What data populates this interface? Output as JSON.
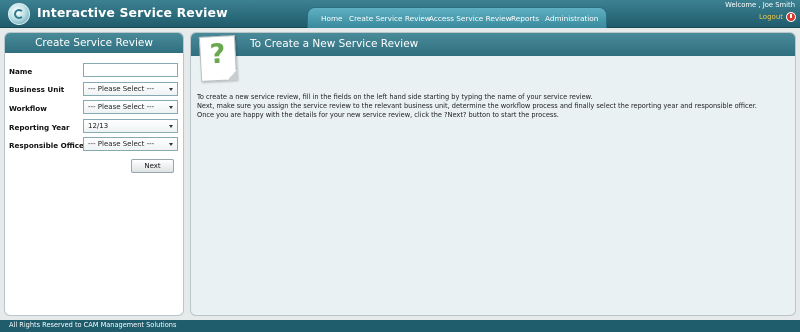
{
  "app": {
    "title": "Interactive Service Review",
    "logo_icon": "swirl-logo-icon"
  },
  "nav": {
    "items": [
      {
        "label": "Home"
      },
      {
        "label": "Create Service Review"
      },
      {
        "label": "Access Service Review"
      },
      {
        "label": "Reports"
      },
      {
        "label": "Administration"
      }
    ]
  },
  "user": {
    "welcome": "Welcome ,  Joe Smith",
    "logout": "Logout",
    "logout_icon": "power-icon"
  },
  "form": {
    "title": "Create Service Review",
    "fields": {
      "name": {
        "label": "Name",
        "value": ""
      },
      "business_unit": {
        "label": "Business Unit",
        "value": "--- Please Select ---"
      },
      "workflow": {
        "label": "Workflow",
        "value": "--- Please Select ---"
      },
      "reporting_year": {
        "label": "Reporting Year",
        "value": "12/13"
      },
      "responsible_officer": {
        "label": "Responsible Officer",
        "value": "--- Please Select ---"
      }
    },
    "next_label": "Next"
  },
  "help": {
    "title": "To Create a New Service Review",
    "icon": "question-document-icon",
    "icon_glyph": "?",
    "lines": [
      "To create a new service review, fill in the fields on the left hand side starting by typing the name of your service review.",
      "Next, make sure you assign the service review to the relevant business unit, determine the workflow process and finally select the reporting year and responsible officer.",
      "Once you are happy with the details for your new service review, click the ?Next? button to start the process."
    ]
  },
  "footer": {
    "text": "All Rights Reserved to CAM Management Solutions"
  },
  "colors": {
    "header_teal": "#2f6f7f",
    "nav_tab": "#4a9cb0",
    "logout_yellow": "#f2c94c",
    "logout_red": "#d9392b",
    "panel_bg": "#e9f1f3",
    "question_green": "#6aa84f"
  }
}
